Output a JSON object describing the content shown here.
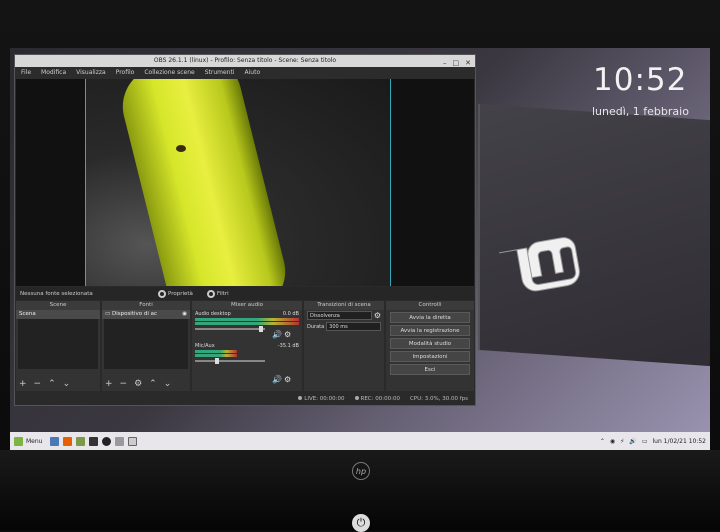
{
  "desktop": {
    "clock": "10:52",
    "date": "lunedì, 1 febbraio"
  },
  "obs": {
    "title": "OBS 26.1.1 (linux) - Profilo: Senza titolo - Scene: Senza titolo",
    "menu": [
      "File",
      "Modifica",
      "Visualizza",
      "Profilo",
      "Collezione scene",
      "Strumenti",
      "Aiuto"
    ],
    "source_bar": {
      "no_source": "Nessuna fonte selezionata",
      "properties": "Proprietà",
      "filters": "Filtri"
    },
    "scenes": {
      "header": "Scene",
      "items": [
        "Scena"
      ]
    },
    "sources": {
      "header": "Fonti",
      "items": [
        "Dispositivo di ac"
      ]
    },
    "mixer": {
      "header": "Mixer audio",
      "channels": [
        {
          "name": "Audio desktop",
          "level": "0.0 dB"
        },
        {
          "name": "Mic/Aux",
          "level": "-35.1 dB"
        }
      ]
    },
    "transitions": {
      "header": "Transizioni di scena",
      "type": "Dissolvenza",
      "duration_label": "Durata",
      "duration": "300 ms"
    },
    "controls": {
      "header": "Controlli",
      "buttons": [
        "Avvia la diretta",
        "Avvia la registrazione",
        "Modalità studio",
        "Impostazioni",
        "Esci"
      ]
    },
    "status": {
      "live": "LIVE: 00:00:00",
      "rec": "REC: 00:00:00",
      "cpu": "CPU: 3.0%, 30.00 fps"
    }
  },
  "taskbar": {
    "menu_label": "Menu",
    "datetime": "lun 1/02/21 10:52"
  },
  "brand": {
    "laptop_logo": "hp",
    "accent": "#3ab0bb"
  }
}
